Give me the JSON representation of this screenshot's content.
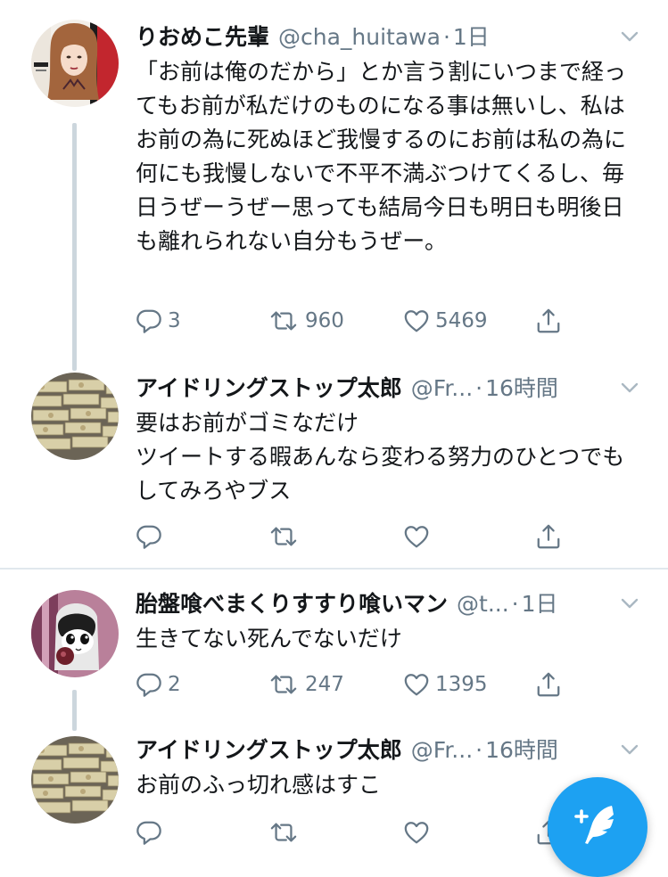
{
  "tweets": [
    {
      "name": "りおめこ先輩",
      "handle": "@cha_huitawa",
      "time": "1日",
      "text": "「お前は俺のだから」とか言う割にいつまで経ってもお前が私だけのものになる事は無いし、私はお前の為に死ぬほど我慢するのにお前は私の為に何にも我慢しないで不平不満ぶつけてくるし、毎日うぜーうぜー思っても結局今日も明日も明後日も離れられない自分もうぜー。",
      "replies": "3",
      "retweets": "960",
      "likes": "5469"
    },
    {
      "name": "アイドリングストップ太郎",
      "handle": "@Fr...",
      "time": "16時間",
      "text": "要はお前がゴミなだけ\nツイートする暇あんなら変わる努力のひとつでもしてみろやブス",
      "replies": "",
      "retweets": "",
      "likes": ""
    },
    {
      "name": "胎盤喰べまくりすすり喰いマン",
      "handle": "@t...",
      "time": "1日",
      "text": "生きてない死んでないだけ",
      "replies": "2",
      "retweets": "247",
      "likes": "1395"
    },
    {
      "name": "アイドリングストップ太郎",
      "handle": "@Fr...",
      "time": "16時間",
      "text": "お前のふっ切れ感はすこ",
      "replies": "",
      "retweets": "",
      "likes": ""
    }
  ],
  "separator": "·",
  "icons": {
    "reply": "reply-icon",
    "retweet": "retweet-icon",
    "like": "heart-icon",
    "share": "share-icon",
    "caret": "chevron-down-icon",
    "compose": "compose-tweet-icon"
  },
  "colors": {
    "accent": "#1da1f2",
    "secondary_text": "#657786",
    "thread_line": "#ccd6dd",
    "divider": "#e1e8ed"
  }
}
